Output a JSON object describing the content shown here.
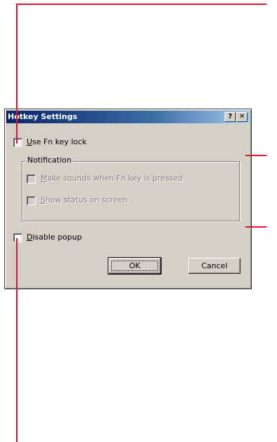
{
  "dialog": {
    "title": "Hotkey Settings",
    "help_button": "?",
    "close_button": "✕"
  },
  "options": {
    "fn_lock": {
      "prefix": "",
      "mnemonic": "U",
      "rest": "se Fn key lock",
      "checked": false
    },
    "notification": {
      "legend": "Notification",
      "sounds": {
        "mnemonic": "M",
        "rest": "ake sounds when Fn key is pressed",
        "checked": false,
        "enabled": false
      },
      "status": {
        "mnemonic": "S",
        "rest": "how status on screen",
        "checked": false,
        "enabled": false
      }
    },
    "disable_popup": {
      "mnemonic": "D",
      "rest": "isable popup",
      "checked": false
    }
  },
  "buttons": {
    "ok": "OK",
    "cancel": "Cancel"
  },
  "colors": {
    "callout": "#e3132b",
    "dialog_face": "#d4d0c8",
    "title_active_start": "#0a246a",
    "title_active_end": "#a6caf0"
  }
}
